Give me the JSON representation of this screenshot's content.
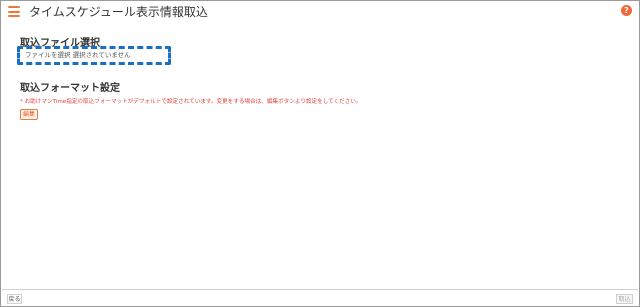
{
  "header": {
    "title": "タイムスケジュール表示情報取込",
    "help_glyph": "?"
  },
  "file_section": {
    "title": "取込ファイル選択",
    "file_input_text": "ファイルを選択 選択されていません"
  },
  "format_section": {
    "title": "取込フォーマット設定",
    "note": "* お助けマンTime指定の取込フォーマットがデフォルトで設定されています。変更をする場合は、編集ボタンより設定をしてください。",
    "edit_label": "編集"
  },
  "footer": {
    "back_label": "戻る",
    "import_label": "取込"
  },
  "colors": {
    "accent": "#e97a3a",
    "focus_border": "#1a6fc4",
    "note_text": "#e0443e"
  }
}
